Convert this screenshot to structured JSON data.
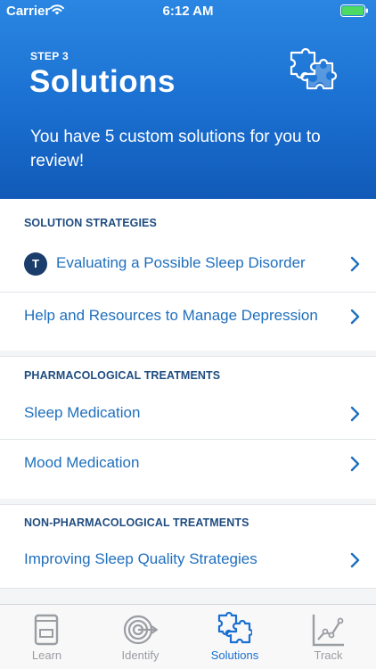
{
  "status_bar": {
    "carrier": "Carrier",
    "time": "6:12 AM"
  },
  "header": {
    "step": "STEP 3",
    "title": "Solutions",
    "subtitle": "You have 5 custom solutions for you to review!",
    "icon": "puzzle-icon"
  },
  "sections": [
    {
      "title": "SOLUTION STRATEGIES",
      "items": [
        {
          "label": "Evaluating a Possible Sleep Disorder",
          "badge": "T"
        },
        {
          "label": "Help and Resources to Manage Depression"
        }
      ]
    },
    {
      "title": "PHARMACOLOGICAL TREATMENTS",
      "items": [
        {
          "label": "Sleep Medication"
        },
        {
          "label": "Mood Medication"
        }
      ]
    },
    {
      "title": "NON-PHARMACOLOGICAL TREATMENTS",
      "items": [
        {
          "label": "Improving Sleep Quality Strategies"
        }
      ]
    }
  ],
  "tabs": [
    {
      "label": "Learn",
      "icon": "book-icon",
      "active": false
    },
    {
      "label": "Identify",
      "icon": "target-icon",
      "active": false
    },
    {
      "label": "Solutions",
      "icon": "puzzle-icon",
      "active": true
    },
    {
      "label": "Track",
      "icon": "chart-icon",
      "active": false
    }
  ],
  "colors": {
    "header_gradient_top": "#2a86e2",
    "header_gradient_bottom": "#115ab8",
    "link": "#1f6fbd",
    "section_title": "#1f4c80",
    "badge": "#1b3d6b",
    "tab_active": "#1a6fd0",
    "tab_inactive": "#9a9da2",
    "battery": "#4cd964"
  }
}
